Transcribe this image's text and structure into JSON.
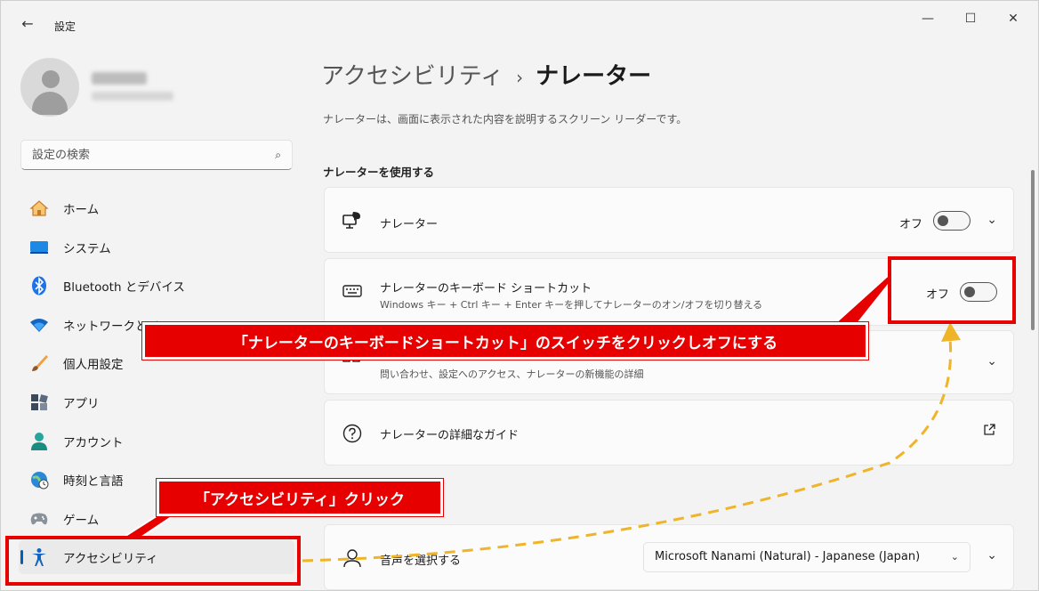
{
  "window": {
    "title": "設定",
    "back_icon": "←",
    "minimize": "—",
    "maximize": "☐",
    "close": "✕"
  },
  "search": {
    "placeholder": "設定の検索",
    "icon": "⌕"
  },
  "sidebar": {
    "items": [
      {
        "label": "ホーム",
        "icon": "home-icon"
      },
      {
        "label": "システム",
        "icon": "monitor-icon"
      },
      {
        "label": "Bluetooth とデバイス",
        "icon": "bluetooth-icon"
      },
      {
        "label": "ネットワークとイ",
        "icon": "wifi-icon"
      },
      {
        "label": "個人用設定",
        "icon": "brush-icon"
      },
      {
        "label": "アプリ",
        "icon": "apps-icon"
      },
      {
        "label": "アカウント",
        "icon": "person-icon"
      },
      {
        "label": "時刻と言語",
        "icon": "globe-clock-icon"
      },
      {
        "label": "ゲーム",
        "icon": "gamepad-icon"
      },
      {
        "label": "アクセシビリティ",
        "icon": "accessibility-icon",
        "active": true
      }
    ]
  },
  "main": {
    "breadcrumb_parent": "アクセシビリティ",
    "breadcrumb_sep": "›",
    "breadcrumb_current": "ナレーター",
    "description": "ナレーターは、画面に表示された内容を説明するスクリーン リーダーです。",
    "section_heading": "ナレーターを使用する",
    "narrator_card": {
      "title": "ナレーター",
      "toggle_label": "オフ",
      "toggle_on": false
    },
    "shortcut_card": {
      "title": "ナレーターのキーボード ショートカット",
      "subtitle": "Windows キー + Ctrl キー + Enter キーを押してナレーターのオン/オフを切り替える",
      "toggle_label": "オフ",
      "toggle_on": false
    },
    "home_card": {
      "subtitle": "問い合わせ、設定へのアクセス、ナレーターの新機能の詳細"
    },
    "guide_card": {
      "title": "ナレーターの詳細なガイド"
    },
    "voice_card": {
      "title": "音声を選択する",
      "value": "Microsoft Nanami (Natural) - Japanese (Japan)"
    }
  },
  "annotations": {
    "callout_shortcut": "「ナレーターのキーボードショートカット」のスイッチをクリックしオフにする",
    "callout_accessibility": "「アクセシビリティ」クリック",
    "color": "#e60000",
    "arrow_color": "#f0b429"
  }
}
